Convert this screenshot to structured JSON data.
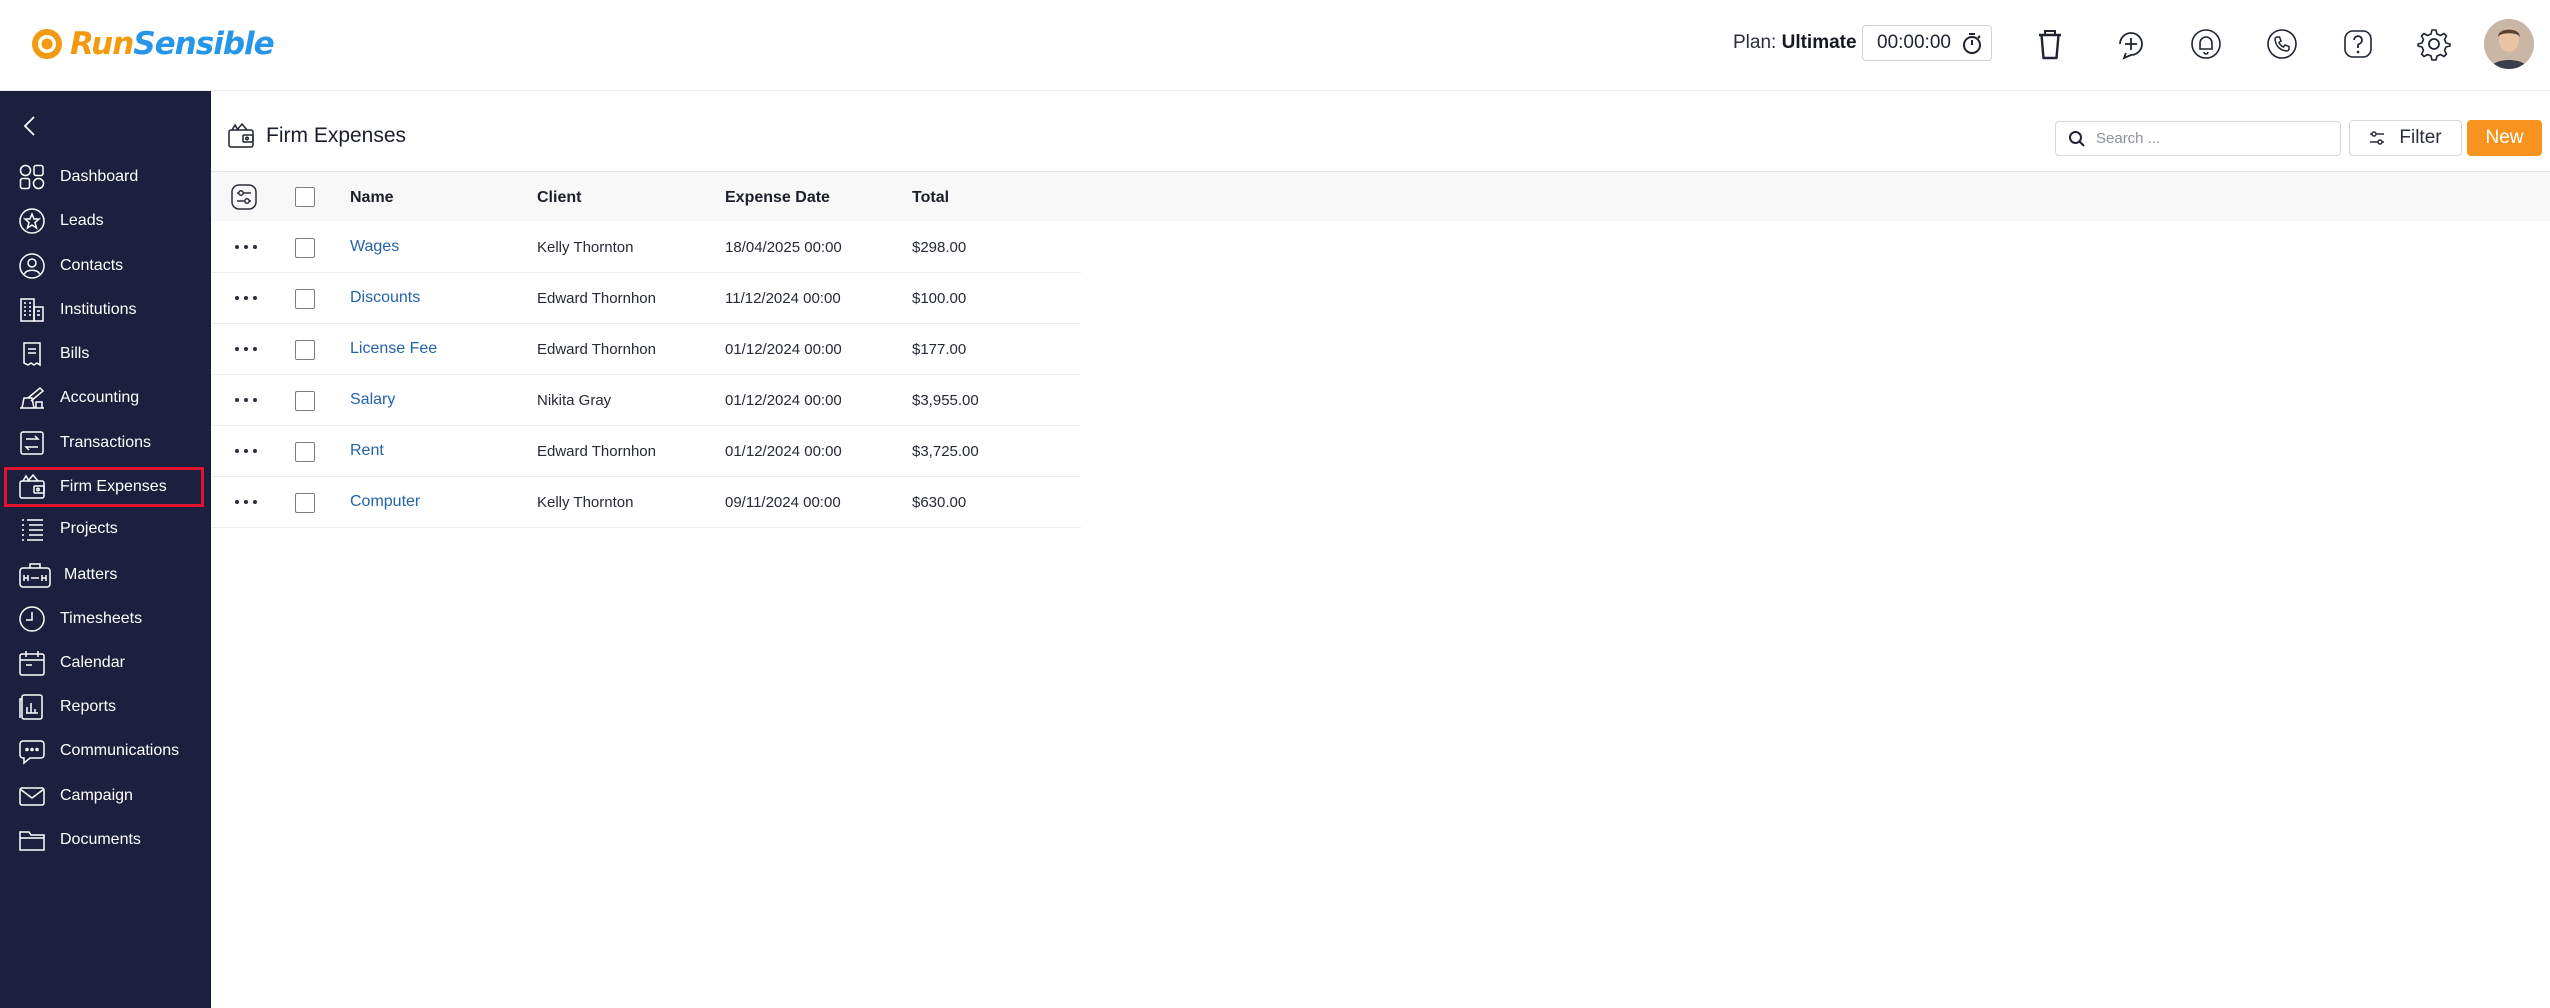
{
  "app": {
    "brand_run": "Run",
    "brand_sensible": "Sensible",
    "plan_label": "Plan:",
    "plan_value": "Ultimate",
    "timer": "00:00:00",
    "colors": {
      "sidebar_bg": "#1d1f3e",
      "accent": "#f7931e",
      "link": "#2362ad",
      "active_outline": "#e0142e"
    }
  },
  "header_icons": [
    "trash-icon",
    "add-reminder-icon",
    "notification-bell-icon",
    "phone-icon",
    "help-icon",
    "settings-gear-icon",
    "user-avatar"
  ],
  "sidebar": {
    "items": [
      {
        "label": "Dashboard",
        "icon": "dashboard-icon"
      },
      {
        "label": "Leads",
        "icon": "star-icon"
      },
      {
        "label": "Contacts",
        "icon": "contact-icon"
      },
      {
        "label": "Institutions",
        "icon": "building-icon"
      },
      {
        "label": "Bills",
        "icon": "bill-icon"
      },
      {
        "label": "Accounting",
        "icon": "accounting-icon"
      },
      {
        "label": "Transactions",
        "icon": "transactions-icon"
      },
      {
        "label": "Firm Expenses",
        "icon": "wallet-icon",
        "active": true
      },
      {
        "label": "Projects",
        "icon": "list-icon"
      },
      {
        "label": "Matters",
        "icon": "briefcase-icon"
      },
      {
        "label": "Timesheets",
        "icon": "clock-icon"
      },
      {
        "label": "Calendar",
        "icon": "calendar-icon"
      },
      {
        "label": "Reports",
        "icon": "report-icon"
      },
      {
        "label": "Communications",
        "icon": "chat-icon"
      },
      {
        "label": "Campaign",
        "icon": "mail-icon"
      },
      {
        "label": "Documents",
        "icon": "folder-icon"
      }
    ]
  },
  "main": {
    "title": "Firm Expenses",
    "search_placeholder": "Search ...",
    "filter_label": "Filter",
    "new_label": "New",
    "columns": [
      "Name",
      "Client",
      "Expense Date",
      "Total"
    ],
    "rows": [
      {
        "name": "Wages",
        "client": "Kelly Thornton",
        "date": "18/04/2025 00:00",
        "total": "$298.00"
      },
      {
        "name": "Discounts",
        "client": "Edward Thornhon",
        "date": "11/12/2024 00:00",
        "total": "$100.00"
      },
      {
        "name": "License Fee",
        "client": "Edward Thornhon",
        "date": "01/12/2024 00:00",
        "total": "$177.00"
      },
      {
        "name": "Salary",
        "client": "Nikita Gray",
        "date": "01/12/2024 00:00",
        "total": "$3,955.00"
      },
      {
        "name": "Rent",
        "client": "Edward Thornhon",
        "date": "01/12/2024 00:00",
        "total": "$3,725.00"
      },
      {
        "name": "Computer",
        "client": "Kelly Thornton",
        "date": "09/11/2024 00:00",
        "total": "$630.00"
      }
    ]
  }
}
